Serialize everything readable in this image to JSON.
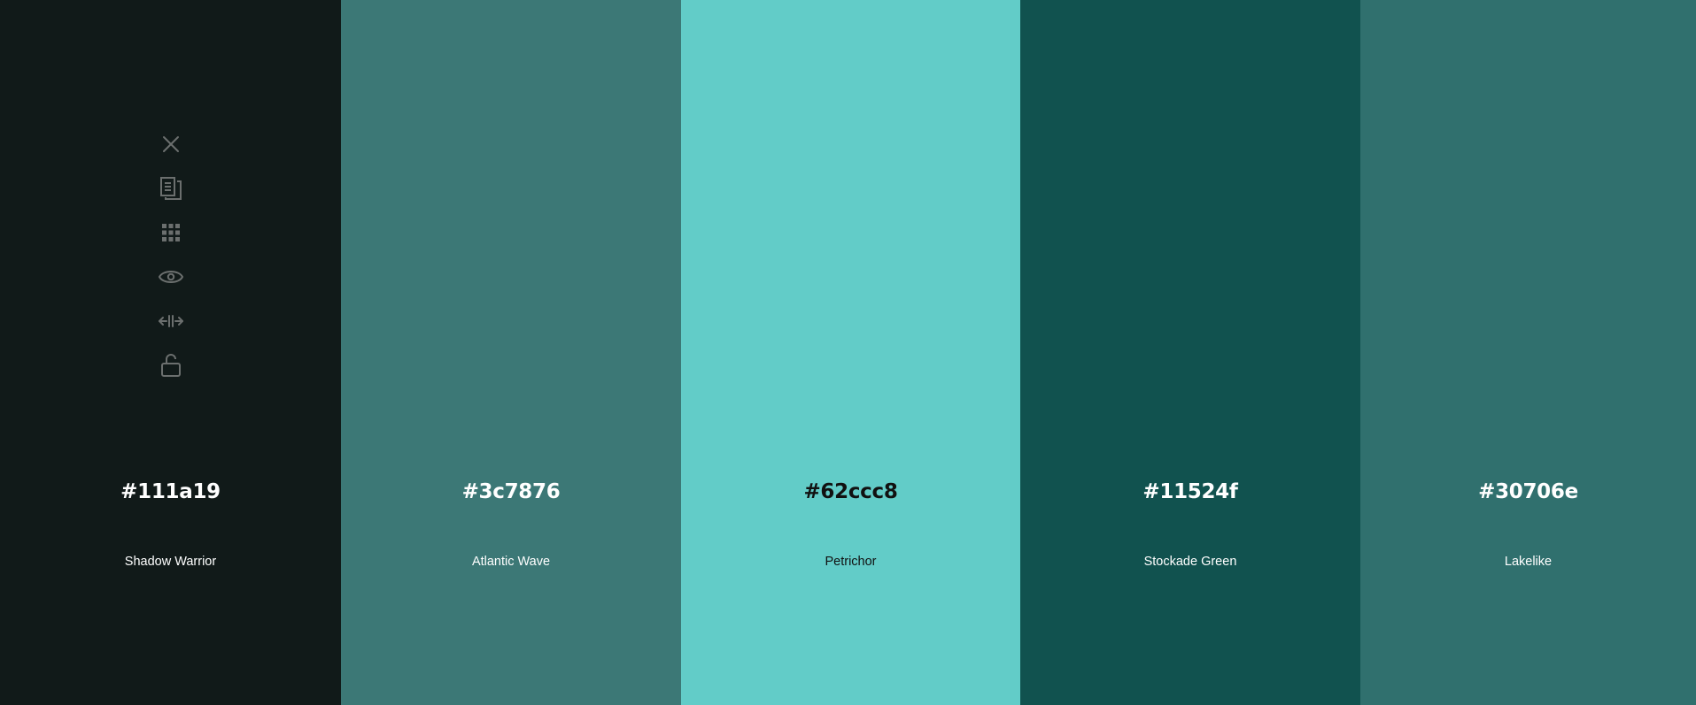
{
  "palette": {
    "colors": [
      {
        "hex": "#111a19",
        "name": "Shadow Warrior",
        "bg": "#111a19",
        "text_color": "#ffffff"
      },
      {
        "hex": "#3c7876",
        "name": "Atlantic Wave",
        "bg": "#3c7876",
        "text_color": "#ffffff"
      },
      {
        "hex": "#62ccc8",
        "name": "Petrichor",
        "bg": "#62ccc8",
        "text_color": "#111111"
      },
      {
        "hex": "#11524f",
        "name": "Stockade Green",
        "bg": "#11524f",
        "text_color": "#ffffff"
      },
      {
        "hex": "#30706e",
        "name": "Lakelike",
        "bg": "#30706e",
        "text_color": "#ffffff"
      }
    ]
  },
  "toolbar": {
    "icon_color": "#6b6f6e",
    "tools": [
      {
        "icon": "close-icon"
      },
      {
        "icon": "copy-icon"
      },
      {
        "icon": "grid-icon"
      },
      {
        "icon": "eye-icon"
      },
      {
        "icon": "resize-horizontal-icon"
      },
      {
        "icon": "unlock-icon"
      }
    ]
  }
}
